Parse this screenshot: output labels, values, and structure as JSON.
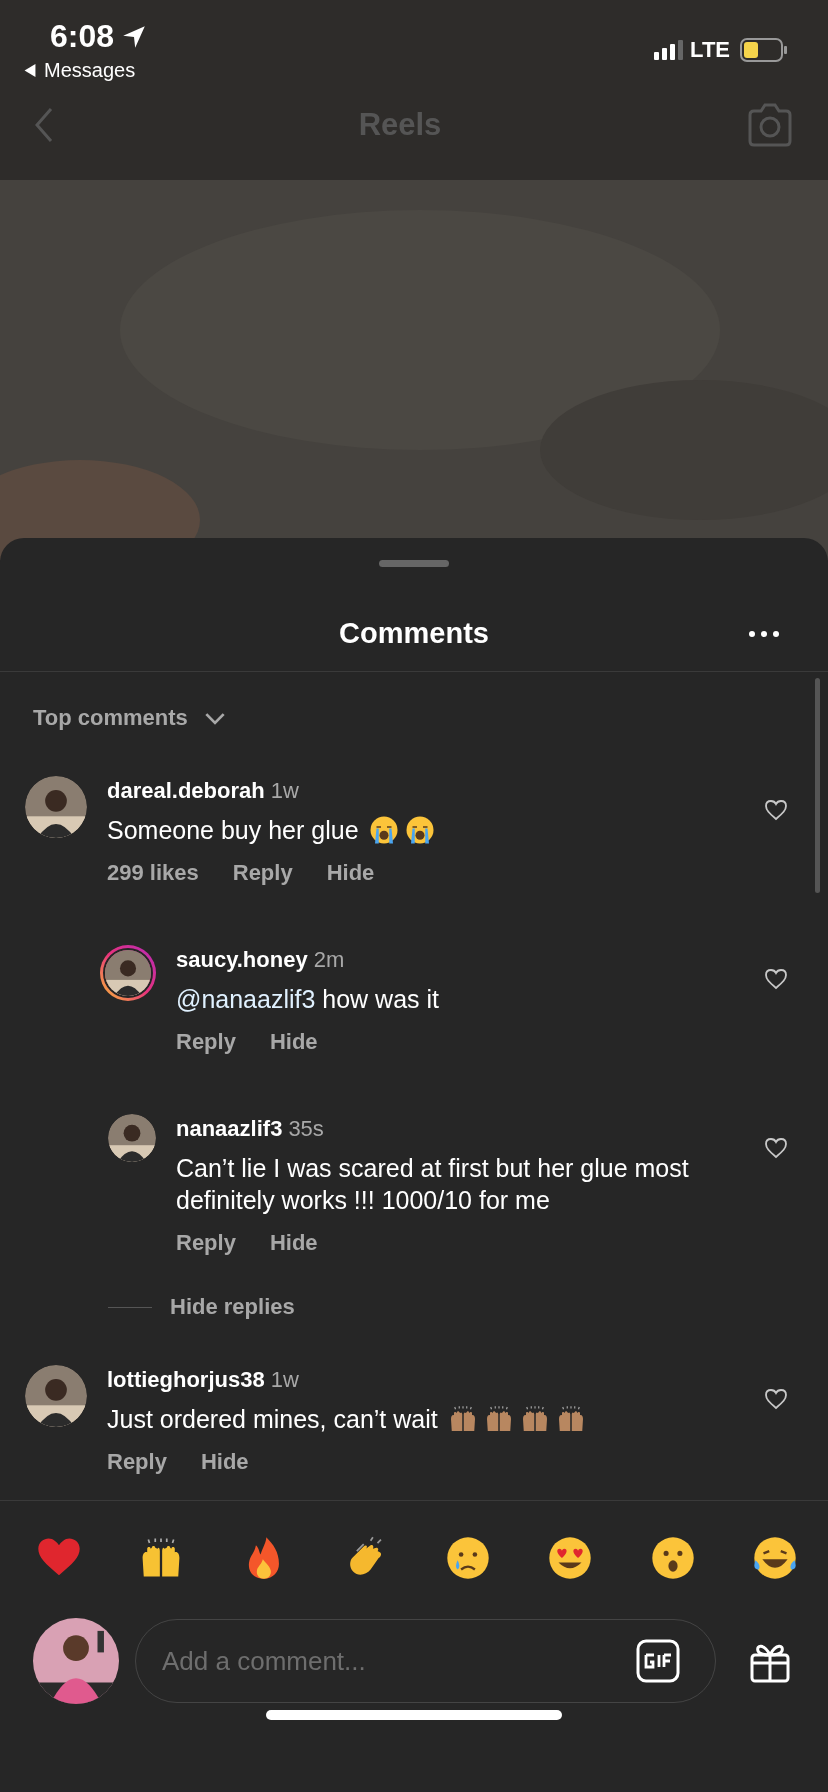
{
  "status_bar": {
    "time": "6:08",
    "back_label": "Messages",
    "network": "LTE"
  },
  "top_nav": {
    "title": "Reels"
  },
  "sheet": {
    "title": "Comments",
    "sort": "Top comments"
  },
  "comments": [
    {
      "username": "dareal.deborah",
      "time": "1w",
      "text": "Someone buy her glue",
      "emojis": [
        {
          "kind": "loud-crying"
        },
        {
          "kind": "loud-crying"
        }
      ],
      "likes": "299 likes",
      "actions": [
        "Reply",
        "Hide"
      ],
      "story_ring": false,
      "liked": false,
      "replies": [
        {
          "username": "saucy.honey",
          "time": "2m",
          "mention": "@nanaazlif3",
          "text": "how was it",
          "actions": [
            "Reply",
            "Hide"
          ],
          "story_ring": true,
          "liked": false
        },
        {
          "username": "nanaazlif3",
          "time": "35s",
          "text": "Can’t lie I was scared at first but her glue most definitely works !!! 1000/10 for me",
          "actions": [
            "Reply",
            "Hide"
          ],
          "story_ring": false,
          "liked": false
        }
      ],
      "hide_replies": "Hide replies"
    },
    {
      "username": "lottieghorjus38",
      "time": "1w",
      "text": "Just ordered mines, can’t wait",
      "emojis": [
        {
          "kind": "raised-hands-medium"
        },
        {
          "kind": "raised-hands-medium"
        },
        {
          "kind": "raised-hands-medium"
        },
        {
          "kind": "raised-hands-medium"
        }
      ],
      "actions": [
        "Reply",
        "Hide"
      ],
      "story_ring": false,
      "liked": false
    }
  ],
  "reactions": [
    {
      "kind": "heart"
    },
    {
      "kind": "raised-hands"
    },
    {
      "kind": "fire"
    },
    {
      "kind": "clap"
    },
    {
      "kind": "crying"
    },
    {
      "kind": "heart-eyes"
    },
    {
      "kind": "surprised"
    },
    {
      "kind": "laughing"
    }
  ],
  "composer": {
    "placeholder": "Add a comment..."
  }
}
